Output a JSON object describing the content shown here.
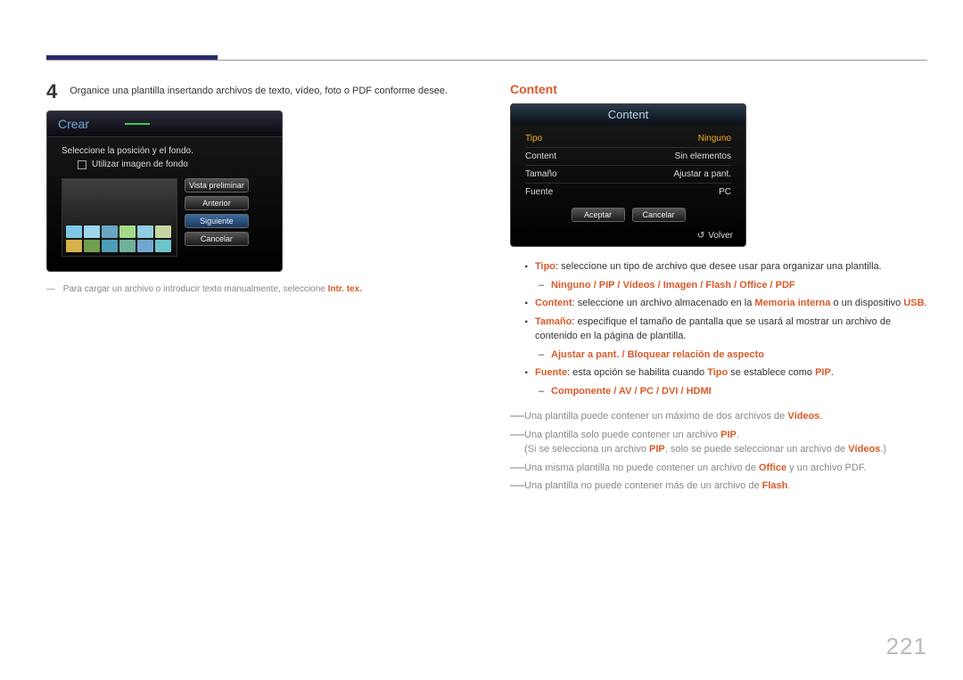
{
  "page_number": "221",
  "step": {
    "number": "4",
    "text": "Organice una plantilla insertando archivos de texto, vídeo, foto o PDF conforme desee."
  },
  "crear": {
    "title": "Crear",
    "subtitle": "Seleccione la posición y el fondo.",
    "checkbox_label": "Utilizar imagen de fondo",
    "buttons": {
      "preview": "Vista preliminar",
      "prev": "Anterior",
      "next": "Siguiente",
      "cancel": "Cancelar"
    }
  },
  "footnote_left": {
    "dash": "―",
    "text": "Para cargar un archivo o introducir texto manualmente, seleccione ",
    "highlight": "Intr. tex."
  },
  "content_section": {
    "heading": "Content",
    "dialog": {
      "title": "Content",
      "rows": {
        "tipo_label": "Tipo",
        "tipo_value": "Ninguno",
        "content_label": "Content",
        "content_value": "Sin elementos",
        "tamano_label": "Tamaño",
        "tamano_value": "Ajustar a pant.",
        "fuente_label": "Fuente",
        "fuente_value": "PC"
      },
      "accept": "Aceptar",
      "cancel": "Cancelar",
      "return": "Volver"
    },
    "bullets": {
      "tipo_lead": "Tipo",
      "tipo_text": ": seleccione un tipo de archivo que desee usar para organizar una plantilla.",
      "tipo_sub": "Ninguno / PIP / Vídeos / Imagen / Flash / Office / PDF",
      "content_lead": "Content",
      "content_text": ": seleccione un archivo almacenado en la ",
      "content_mid": "Memoria interna",
      "content_text2": " o un dispositivo ",
      "content_end": "USB",
      "tamano_lead": "Tamaño",
      "tamano_text": ": especifique el tamaño de pantalla que se usará al mostrar un archivo de contenido en la página de plantilla.",
      "tamano_sub": "Ajustar a pant. / Bloquear relación de aspecto",
      "fuente_lead": "Fuente",
      "fuente_text": ": esta opción se habilita cuando ",
      "fuente_mid": "Tipo",
      "fuente_text2": " se establece como ",
      "fuente_end": "PIP",
      "fuente_sub": "Componente / AV / PC / DVI / HDMI"
    },
    "notes": {
      "n1a": "Una plantilla puede contener un máximo de dos archivos de ",
      "n1b": "Vídeos",
      "n2a": "Una plantilla solo puede contener un archivo ",
      "n2b": "PIP",
      "n2c": "(Si se selecciona un archivo ",
      "n2d": "PIP",
      "n2e": ", solo se puede seleccionar un archivo de ",
      "n2f": "Vídeos",
      "n2g": ".)",
      "n3a": "Una misma plantilla no puede contener un archivo de ",
      "n3b": "Office",
      "n3c": " y un archivo PDF.",
      "n4a": "Una plantilla no puede contener más de un archivo de ",
      "n4b": "Flash"
    }
  }
}
